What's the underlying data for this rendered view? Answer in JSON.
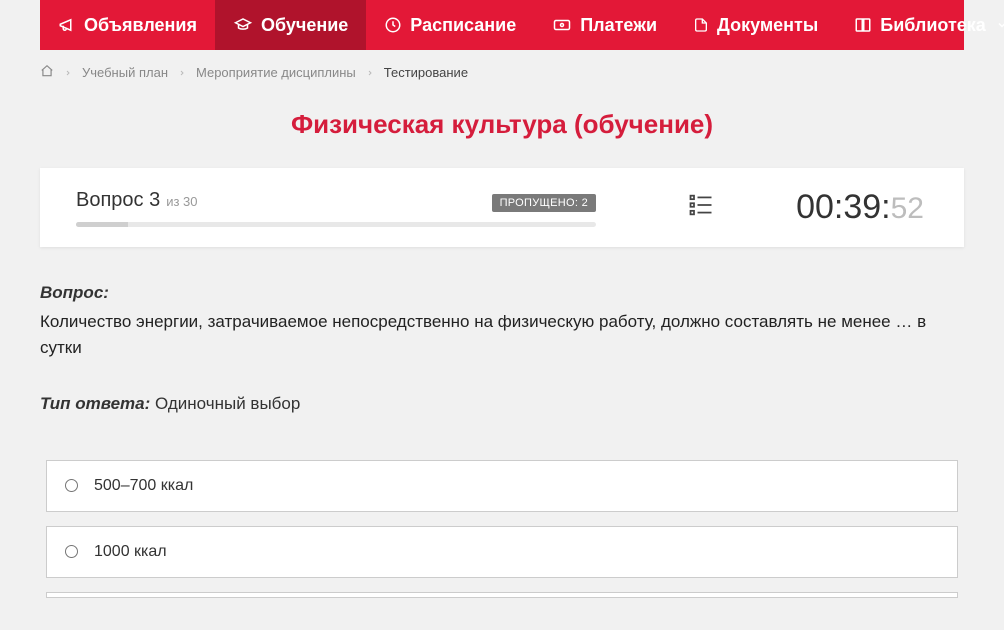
{
  "nav": {
    "items": [
      {
        "label": "Объявления"
      },
      {
        "label": "Обучение"
      },
      {
        "label": "Расписание"
      },
      {
        "label": "Платежи"
      },
      {
        "label": "Документы"
      },
      {
        "label": "Библиотека"
      }
    ]
  },
  "breadcrumb": {
    "study_plan": "Учебный план",
    "discipline_event": "Мероприятие дисциплины",
    "current": "Тестирование"
  },
  "title": "Физическая культура (обучение)",
  "status": {
    "question_label": "Вопрос 3",
    "of_label": "из 30",
    "skipped_label": "ПРОПУЩЕНО: 2",
    "progress_percent": 10
  },
  "timer": {
    "main": "00:39:",
    "seconds": "52"
  },
  "question": {
    "heading": "Вопрос:",
    "text": "Количество энергии, затрачиваемое непосредственно на физическую работу, должно составлять не менее … в сутки",
    "answer_type_label": "Тип ответа:",
    "answer_type_value": "Одиночный выбор"
  },
  "answers": [
    {
      "text": "500–700 ккал"
    },
    {
      "text": "1000 ккал"
    }
  ]
}
